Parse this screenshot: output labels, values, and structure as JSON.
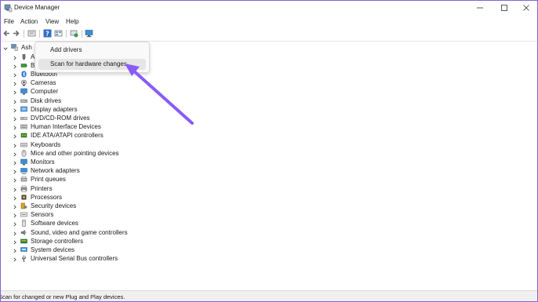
{
  "window": {
    "title": "Device Manager"
  },
  "menu": [
    "File",
    "Action",
    "View",
    "Help"
  ],
  "toolbar": {
    "icons": [
      "back-arrow-icon",
      "forward-arrow-icon",
      "properties-icon",
      "help-icon",
      "show-hidden-icon",
      "update-driver-icon",
      "monitor-icon"
    ]
  },
  "tree": {
    "root_label": "Ash",
    "items": [
      {
        "label": "A",
        "icon": "audio-inputs-icon"
      },
      {
        "label": "B",
        "icon": "batteries-icon"
      },
      {
        "label": "Bluetooth",
        "icon": "bluetooth-icon"
      },
      {
        "label": "Cameras",
        "icon": "camera-icon"
      },
      {
        "label": "Computer",
        "icon": "computer-icon"
      },
      {
        "label": "Disk drives",
        "icon": "disk-drive-icon"
      },
      {
        "label": "Display adapters",
        "icon": "display-adapter-icon"
      },
      {
        "label": "DVD/CD-ROM drives",
        "icon": "dvd-drive-icon"
      },
      {
        "label": "Human Interface Devices",
        "icon": "hid-icon"
      },
      {
        "label": "IDE ATA/ATAPI controllers",
        "icon": "ide-controller-icon"
      },
      {
        "label": "Keyboards",
        "icon": "keyboard-icon"
      },
      {
        "label": "Mice and other pointing devices",
        "icon": "mouse-icon"
      },
      {
        "label": "Monitors",
        "icon": "monitor-icon"
      },
      {
        "label": "Network adapters",
        "icon": "network-adapter-icon"
      },
      {
        "label": "Print queues",
        "icon": "print-queue-icon"
      },
      {
        "label": "Printers",
        "icon": "printer-icon"
      },
      {
        "label": "Processors",
        "icon": "processor-icon"
      },
      {
        "label": "Security devices",
        "icon": "security-device-icon"
      },
      {
        "label": "Sensors",
        "icon": "sensor-icon"
      },
      {
        "label": "Software devices",
        "icon": "software-device-icon"
      },
      {
        "label": "Sound, video and game controllers",
        "icon": "sound-icon"
      },
      {
        "label": "Storage controllers",
        "icon": "storage-controller-icon"
      },
      {
        "label": "System devices",
        "icon": "system-device-icon"
      },
      {
        "label": "Universal Serial Bus controllers",
        "icon": "usb-icon"
      }
    ]
  },
  "context_menu": {
    "items": [
      {
        "label": "Add drivers"
      },
      {
        "label": "Scan for hardware changes"
      }
    ]
  },
  "annotation": {
    "arrow_color": "#8a5cf6"
  },
  "status": {
    "text": "Scan for changed or new Plug and Play devices."
  }
}
